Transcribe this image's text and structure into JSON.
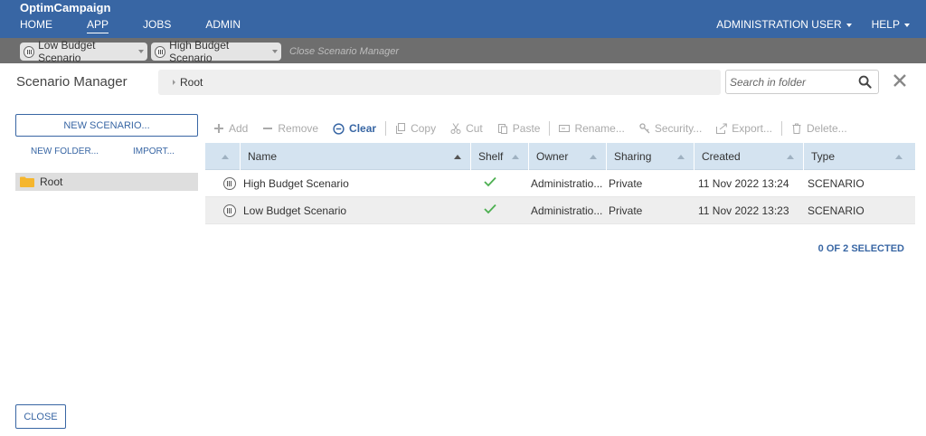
{
  "app": {
    "title": "OptimCampaign",
    "nav": [
      "HOME",
      "APP",
      "JOBS",
      "ADMIN"
    ],
    "active_nav": "APP",
    "user_menu": "ADMINISTRATION USER",
    "help_menu": "HELP"
  },
  "scenario_tabs": [
    {
      "label": "Low Budget Scenario"
    },
    {
      "label": "High Budget Scenario"
    }
  ],
  "close_manager_link": "Close Scenario Manager",
  "dialog": {
    "title": "Scenario Manager",
    "breadcrumb": "Root",
    "search_placeholder": "Search in folder",
    "new_scenario_button": "NEW SCENARIO...",
    "new_folder_link": "NEW FOLDER...",
    "import_link": "IMPORT...",
    "tree_root": "Root",
    "toolbar": {
      "add": "Add",
      "remove": "Remove",
      "clear": "Clear",
      "copy": "Copy",
      "cut": "Cut",
      "paste": "Paste",
      "rename": "Rename...",
      "security": "Security...",
      "export": "Export...",
      "delete": "Delete..."
    },
    "columns": {
      "name": "Name",
      "shelf": "Shelf",
      "owner": "Owner",
      "sharing": "Sharing",
      "created": "Created",
      "type": "Type"
    },
    "rows": [
      {
        "name": "High Budget Scenario",
        "shelf": true,
        "owner": "Administratio...",
        "sharing": "Private",
        "created": "11 Nov 2022 13:24",
        "type": "SCENARIO"
      },
      {
        "name": "Low Budget Scenario",
        "shelf": true,
        "owner": "Administratio...",
        "sharing": "Private",
        "created": "11 Nov 2022 13:23",
        "type": "SCENARIO"
      }
    ],
    "selection_count": "0 OF 2 SELECTED",
    "close_button": "CLOSE"
  },
  "colors": {
    "brand_blue": "#3866a4",
    "header_row": "#d4e3f0",
    "check_green": "#4caf50"
  }
}
